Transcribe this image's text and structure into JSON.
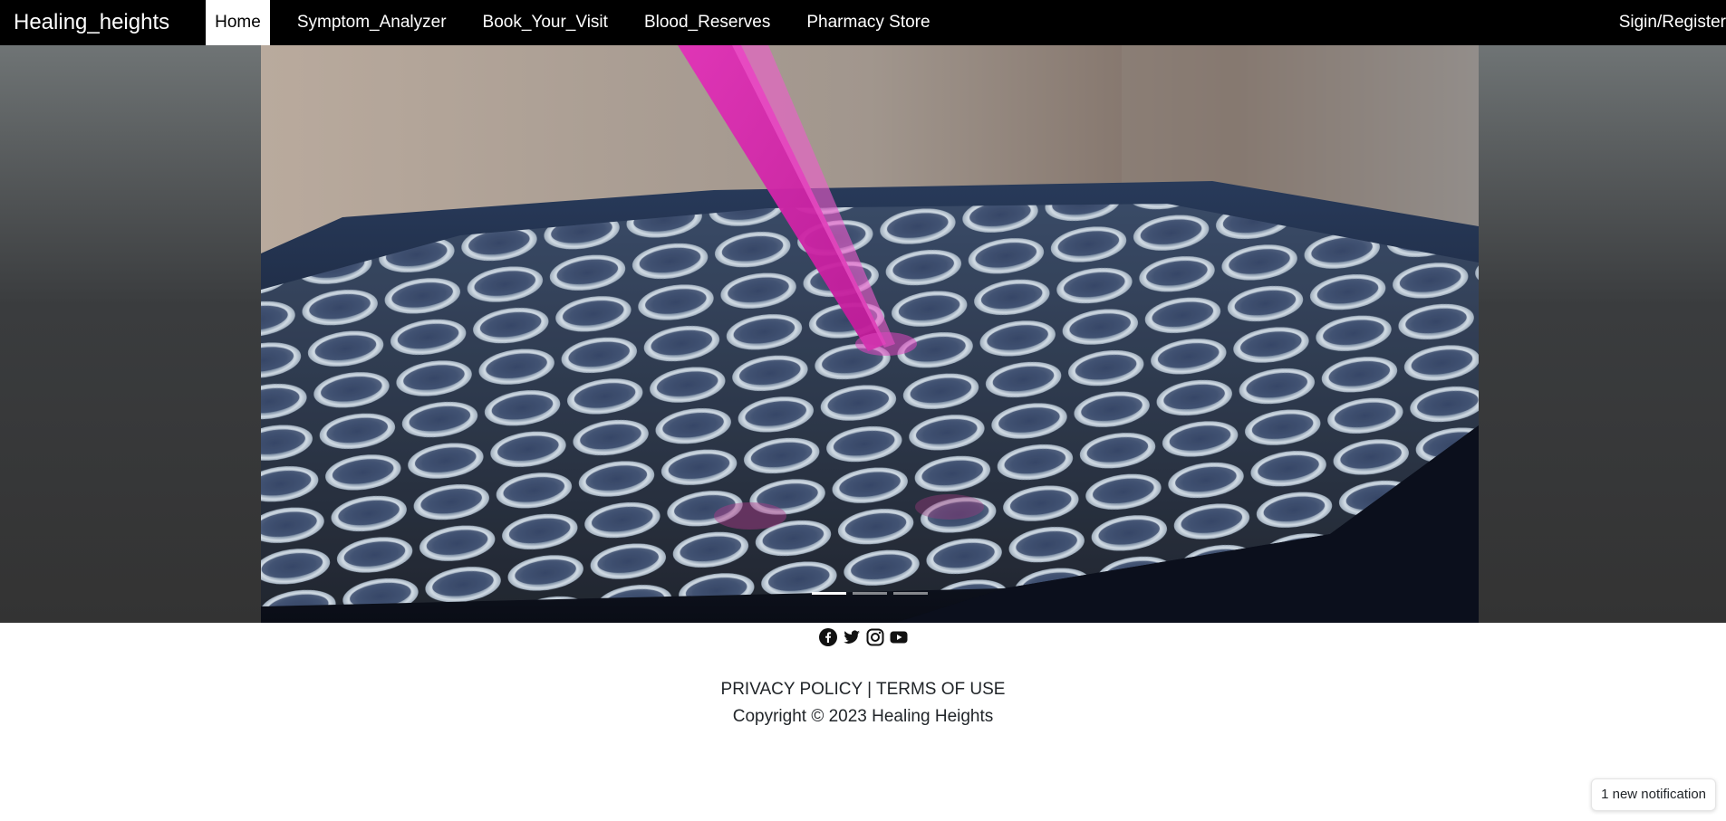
{
  "navbar": {
    "brand": "Healing_heights",
    "items": [
      {
        "label": "Home",
        "active": true
      },
      {
        "label": "Symptom_Analyzer"
      },
      {
        "label": "Book_Your_Visit"
      },
      {
        "label": "Blood_Reserves"
      },
      {
        "label": "Pharmacy Store"
      }
    ],
    "signin": "Sigin/Register"
  },
  "carousel": {
    "image": "laboratory-test-tubes-with-pink-pipette",
    "slides": 3,
    "active_slide": 1
  },
  "footer": {
    "social_icons": [
      "facebook-icon",
      "twitter-icon",
      "instagram-icon",
      "youtube-icon"
    ],
    "privacy": "PRIVACY POLICY",
    "separator": "|",
    "terms": "TERMS OF USE",
    "copyright": "Copyright © 2023 Healing Heights"
  },
  "toast": {
    "text": "1 new notification"
  }
}
